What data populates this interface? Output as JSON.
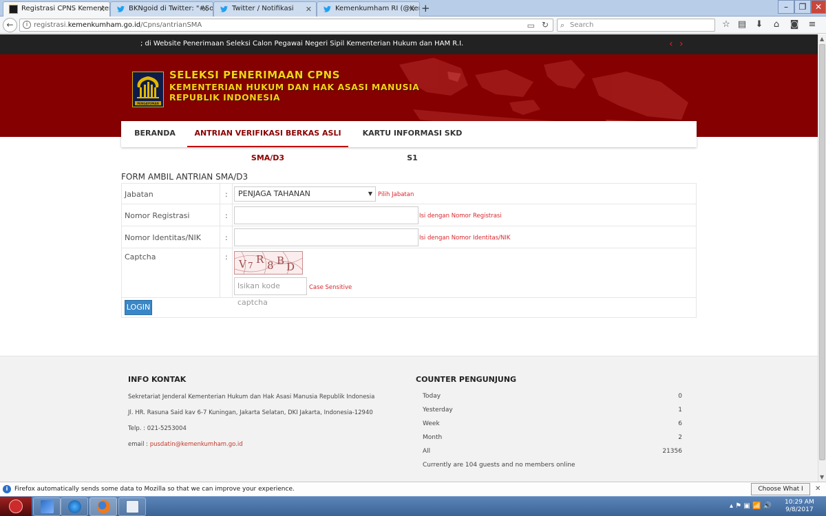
{
  "browser": {
    "tabs": [
      {
        "title": "Registrasi CPNS Kementeri...",
        "active": true,
        "favicon": "pengayoman-logo"
      },
      {
        "title": "BKNgoid di Twitter: \"#Sob...",
        "active": false,
        "favicon": "twitter-bird-icon"
      },
      {
        "title": "Twitter / Notifikasi",
        "active": false,
        "favicon": "twitter-bird-icon"
      },
      {
        "title": "Kemenkumham RI (@Kem...",
        "active": false,
        "favicon": "twitter-bird-icon"
      }
    ],
    "url_prefix": "registrasi.",
    "url_domain": "kemenkumham.go.id",
    "url_path": "/Cpns/antrianSMA",
    "search_placeholder": "Search"
  },
  "ticker": {
    "text": "; di Website Penerimaan Seleksi Calon Pegawai Negeri Sipil Kementerian Hukum dan HAM R.I.",
    "prev": "‹",
    "next": "›"
  },
  "banner": {
    "title_line1": "SELEKSI PENERIMAAN CPNS",
    "title_line2": "KEMENTERIAN HUKUM DAN HAK ASASI MANUSIA",
    "title_line3": "REPUBLIK INDONESIA",
    "logo_caption": "PENGAYOMAN"
  },
  "menu": {
    "items": [
      {
        "label": "BERANDA",
        "active": false
      },
      {
        "label": "ANTRIAN VERIFIKASI BERKAS ASLI SMA/D3",
        "active": true
      },
      {
        "label": "KARTU INFORMASI SKD S1",
        "active": false
      }
    ]
  },
  "form": {
    "title": "FORM AMBIL ANTRIAN SMA/D3",
    "colon": ":",
    "jabatan": {
      "label": "Jabatan",
      "value": "PENJAGA TAHANAN",
      "hint": "Pilih Jabatan"
    },
    "nomor_registrasi": {
      "label": "Nomor Registrasi",
      "value": "",
      "hint": "Isi dengan Nomor Registrasi"
    },
    "nomor_identitas": {
      "label": "Nomor Identitas/NIK",
      "value": "",
      "hint": "Isi dengan Nomor Identitas/NIK"
    },
    "captcha": {
      "label": "Captcha",
      "code": "V7R8BD",
      "placeholder": "Isikan kode captcha",
      "hint": "Case Sensitive"
    },
    "login_label": "LOGIN"
  },
  "footer": {
    "info_title": "INFO KONTAK",
    "info_lines": [
      "Sekretariat Jenderal Kementerian Hukum dan Hak Asasi Manusia Republik Indonesia",
      "Jl. HR. Rasuna Said kav 6-7 Kuningan, Jakarta Selatan, DKI Jakarta, Indonesia-12940",
      "Telp. : 021-5253004"
    ],
    "email_label": "email : ",
    "email": "pusdatin@kemenkumham.go.id",
    "counter_title": "COUNTER PENGUNJUNG",
    "counter": [
      {
        "label": "Today",
        "value": "0"
      },
      {
        "label": "Yesterday",
        "value": "1"
      },
      {
        "label": "Week",
        "value": "6"
      },
      {
        "label": "Month",
        "value": "2"
      },
      {
        "label": "All",
        "value": "21356"
      }
    ],
    "online_text": "Currently are 104 guests and no members online"
  },
  "notification": {
    "text": "Firefox automatically sends some data to Mozilla so that we can improve your experience.",
    "button": "Choose What I Share"
  },
  "taskbar": {
    "time": "10:29 AM",
    "date": "9/8/2017"
  },
  "colors": {
    "banner": "#850000",
    "banner_text": "#f6d215",
    "menu_active": "#8b0000",
    "hint": "#d9252a",
    "login_button": "#3a87c8"
  }
}
